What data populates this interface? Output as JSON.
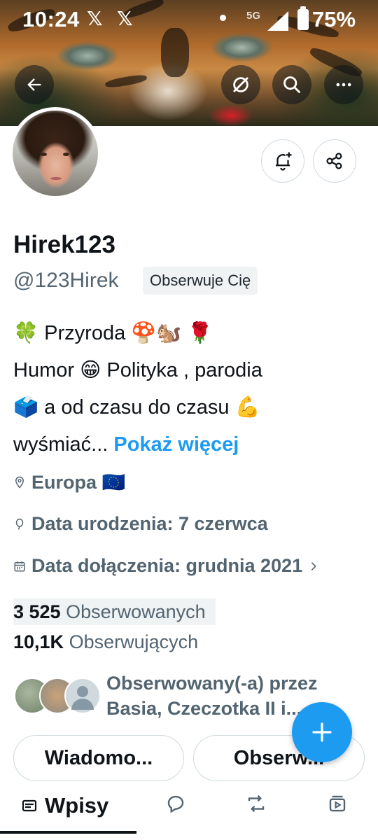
{
  "status_bar": {
    "time": "10:24",
    "x_icon_1": "𝕏",
    "x_icon_2": "𝕏",
    "network": "5G",
    "battery": "75%"
  },
  "header": {
    "back_icon": "arrow-left-icon",
    "grok_icon": "grok-icon",
    "search_icon": "search-icon",
    "more_icon": "more-icon"
  },
  "profile": {
    "name": "Hirek123",
    "handle": "@123Hirek",
    "follows_you_badge": "Obserwuje Cię",
    "bio": {
      "line1": "🍀 Przyroda 🍄🐿️ 🌹",
      "line2": "Humor  😁  Polityka , parodia",
      "line3": "🗳️ a od czasu do czasu  💪",
      "line4": "wyśmiać...",
      "show_more": "Pokaż więcej"
    },
    "location": "Europa 🇪🇺",
    "birthday": "Data urodzenia: 7 czerwca",
    "joined": "Data dołączenia: grudnia 2021",
    "following_count": "3 525",
    "following_label": "Obserwowanych",
    "followers_count": "10,1K",
    "followers_label": "Obserwujących",
    "followed_by_line1": "Obserwowany(-a) przez",
    "followed_by_line2": "Basia, Czeczotka II i...",
    "message_button": "Wiadomo...",
    "follow_button": "Obserw..."
  },
  "tabs": {
    "posts": "Wpisy"
  },
  "colors": {
    "accent": "#1d9bf0",
    "text": "#0f1419",
    "muted": "#536471"
  }
}
